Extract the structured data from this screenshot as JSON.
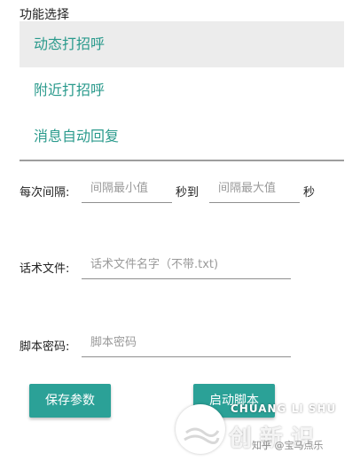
{
  "function_section": {
    "label": "功能选择",
    "items": [
      {
        "label": "动态打招呼",
        "selected": true
      },
      {
        "label": "附近打招呼",
        "selected": false
      },
      {
        "label": "消息自动回复",
        "selected": false
      }
    ]
  },
  "interval": {
    "label": "每次间隔:",
    "min_placeholder": "间隔最小值",
    "to_label": "秒到",
    "max_placeholder": "间隔最大值",
    "unit": "秒"
  },
  "script_file": {
    "label": "话术文件:",
    "placeholder": "话术文件名字（不带.txt)"
  },
  "password": {
    "label": "脚本密码:",
    "placeholder": "脚本密码"
  },
  "buttons": {
    "save": "保存参数",
    "start": "启动脚本"
  },
  "watermark": {
    "line1": "CHUANG LI SHU",
    "line2": "创 新 识",
    "line3": "知乎 @宝马点乐"
  },
  "colors": {
    "accent": "#2ba197",
    "menu_text": "#2a9a8c",
    "selected_bg": "#ececec"
  }
}
